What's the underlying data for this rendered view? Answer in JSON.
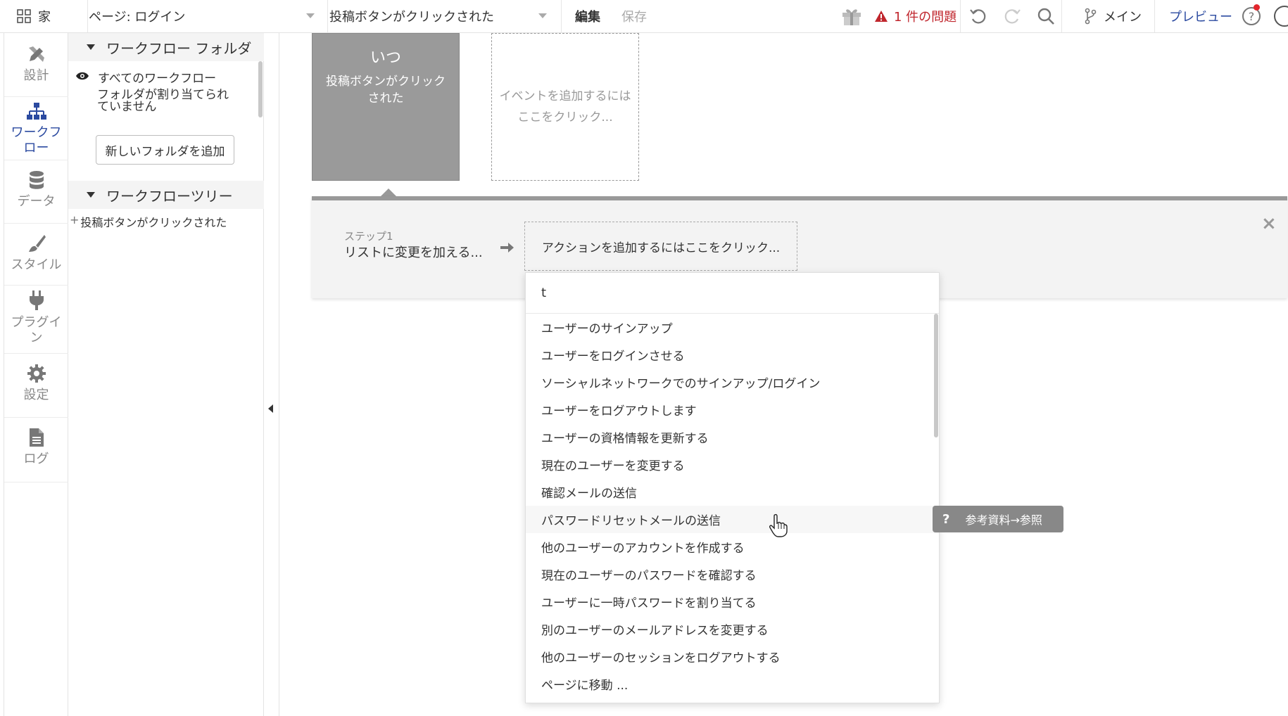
{
  "topbar": {
    "home_label": "家",
    "page_label": "ページ: ログイン",
    "event_label": "投稿ボタンがクリックされた",
    "edit_label": "編集",
    "save_label": "保存",
    "issues_label": "1 件の問題",
    "branch_label": "メイン",
    "preview_label": "プレビュー"
  },
  "leftnav": {
    "items": [
      {
        "label": "設計",
        "icon": "design-icon"
      },
      {
        "label": "ワークフロー",
        "icon": "workflow-icon"
      },
      {
        "label": "データ",
        "icon": "database-icon"
      },
      {
        "label": "スタイル",
        "icon": "brush-icon"
      },
      {
        "label": "プラグイン",
        "icon": "plug-icon"
      },
      {
        "label": "設定",
        "icon": "gear-icon"
      },
      {
        "label": "ログ",
        "icon": "document-icon"
      }
    ]
  },
  "folders": {
    "section_title": "ワークフロー フォルダ",
    "all_workflows": "すべてのワークフロー",
    "unassigned": "フォルダが割り当てられていません",
    "add_folder_button": "新しいフォルダを追加",
    "tree_title": "ワークフローツリー",
    "tree_items": [
      "投稿ボタンがクリックされた"
    ]
  },
  "events": {
    "when_label": "いつ",
    "when_event": "投稿ボタンがクリックされた",
    "add_event": "イベントを追加するにはここをクリック..."
  },
  "step": {
    "label": "ステップ1",
    "title": "リストに変更を加える...",
    "add_action": "アクションを追加するにはここをクリック..."
  },
  "dropdown": {
    "search_value": "t",
    "items": [
      "ユーザーのサインアップ",
      "ユーザーをログインさせる",
      "ソーシャルネットワークでのサインアップ/ログイン",
      "ユーザーをログアウトします",
      "ユーザーの資格情報を更新する",
      "現在のユーザーを変更する",
      "確認メールの送信",
      "パスワードリセットメールの送信",
      "他のユーザーのアカウントを作成する",
      "現在のユーザーのパスワードを確認する",
      "ユーザーに一時パスワードを割り当てる",
      "別のユーザーのメールアドレスを変更する",
      "他のユーザーのセッションをログアウトする",
      "ページに移動 ..."
    ],
    "hovered_index": 7
  },
  "reference_tag": {
    "q": "?",
    "label": "参考資料→参照"
  },
  "colors": {
    "accent": "#2b4aa0",
    "error": "#c0262d",
    "event_block": "#9a9a9a"
  }
}
